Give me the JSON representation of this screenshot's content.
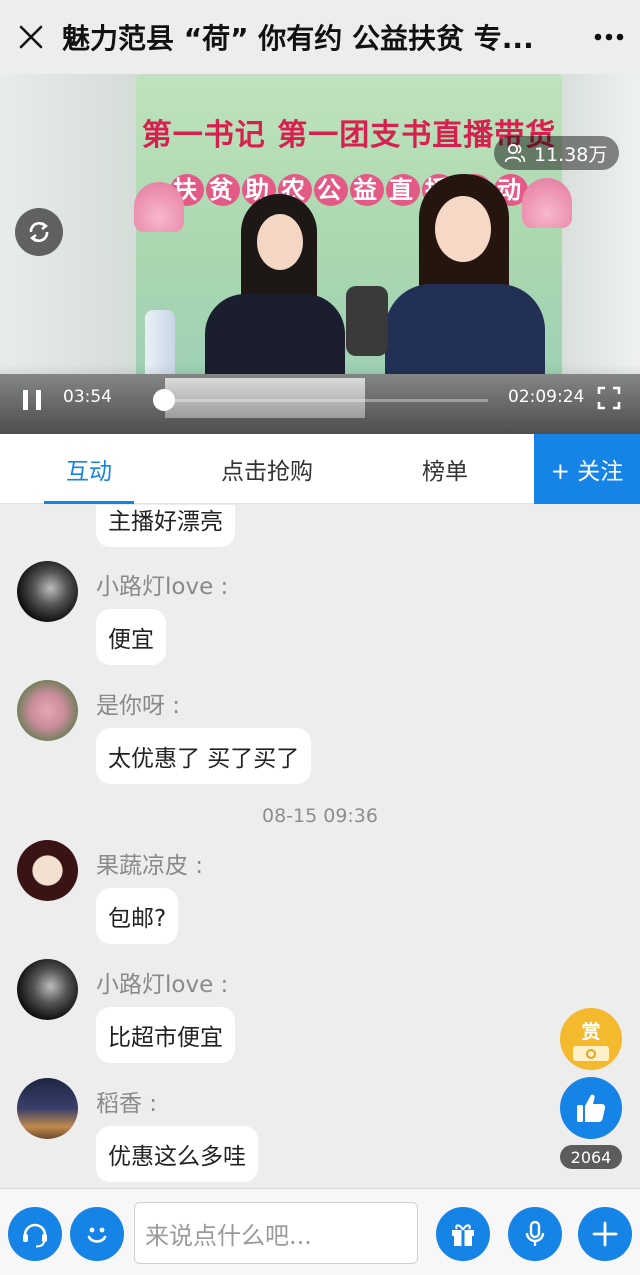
{
  "header": {
    "title": "魅力范县 “荷” 你有约 公益扶贫 专..."
  },
  "video": {
    "banner_line1": "第一书记  第一团支书直播带货",
    "banner_line2": "扶贫助农公益直播活动",
    "viewers": "11.38万",
    "current_time": "03:54",
    "duration": "02:09:24",
    "progress_fraction": 0.03
  },
  "tabs": {
    "items": [
      "互动",
      "点击抢购",
      "榜单"
    ],
    "active": 0,
    "follow_label": "+ 关注"
  },
  "chat": {
    "messages": [
      {
        "text": "主播好漂亮"
      },
      {
        "name": "小路灯love :",
        "text": "便宜"
      },
      {
        "name": "是你呀 :",
        "text": "太优惠了 买了买了"
      },
      {
        "timestamp": "08-15 09:36"
      },
      {
        "name": "果蔬凉皮 :",
        "text": "包邮?"
      },
      {
        "name": "小路灯love :",
        "text": "比超市便宜"
      },
      {
        "name": "稻香 :",
        "text": "优惠这么多哇"
      }
    ]
  },
  "floating": {
    "reward_label": "赏",
    "like_count": "2064"
  },
  "bottom": {
    "input_placeholder": "来说点什么吧..."
  },
  "colors": {
    "accent": "#1683e6",
    "reward": "#f5b92e",
    "banner_text": "#d8204f"
  },
  "icons": [
    "close-icon",
    "more-icon",
    "viewers-icon",
    "refresh-icon",
    "pause-icon",
    "fullscreen-icon",
    "thumbs-up-icon",
    "customer-service-icon",
    "emoji-icon",
    "gift-icon",
    "microphone-icon",
    "plus-icon"
  ]
}
